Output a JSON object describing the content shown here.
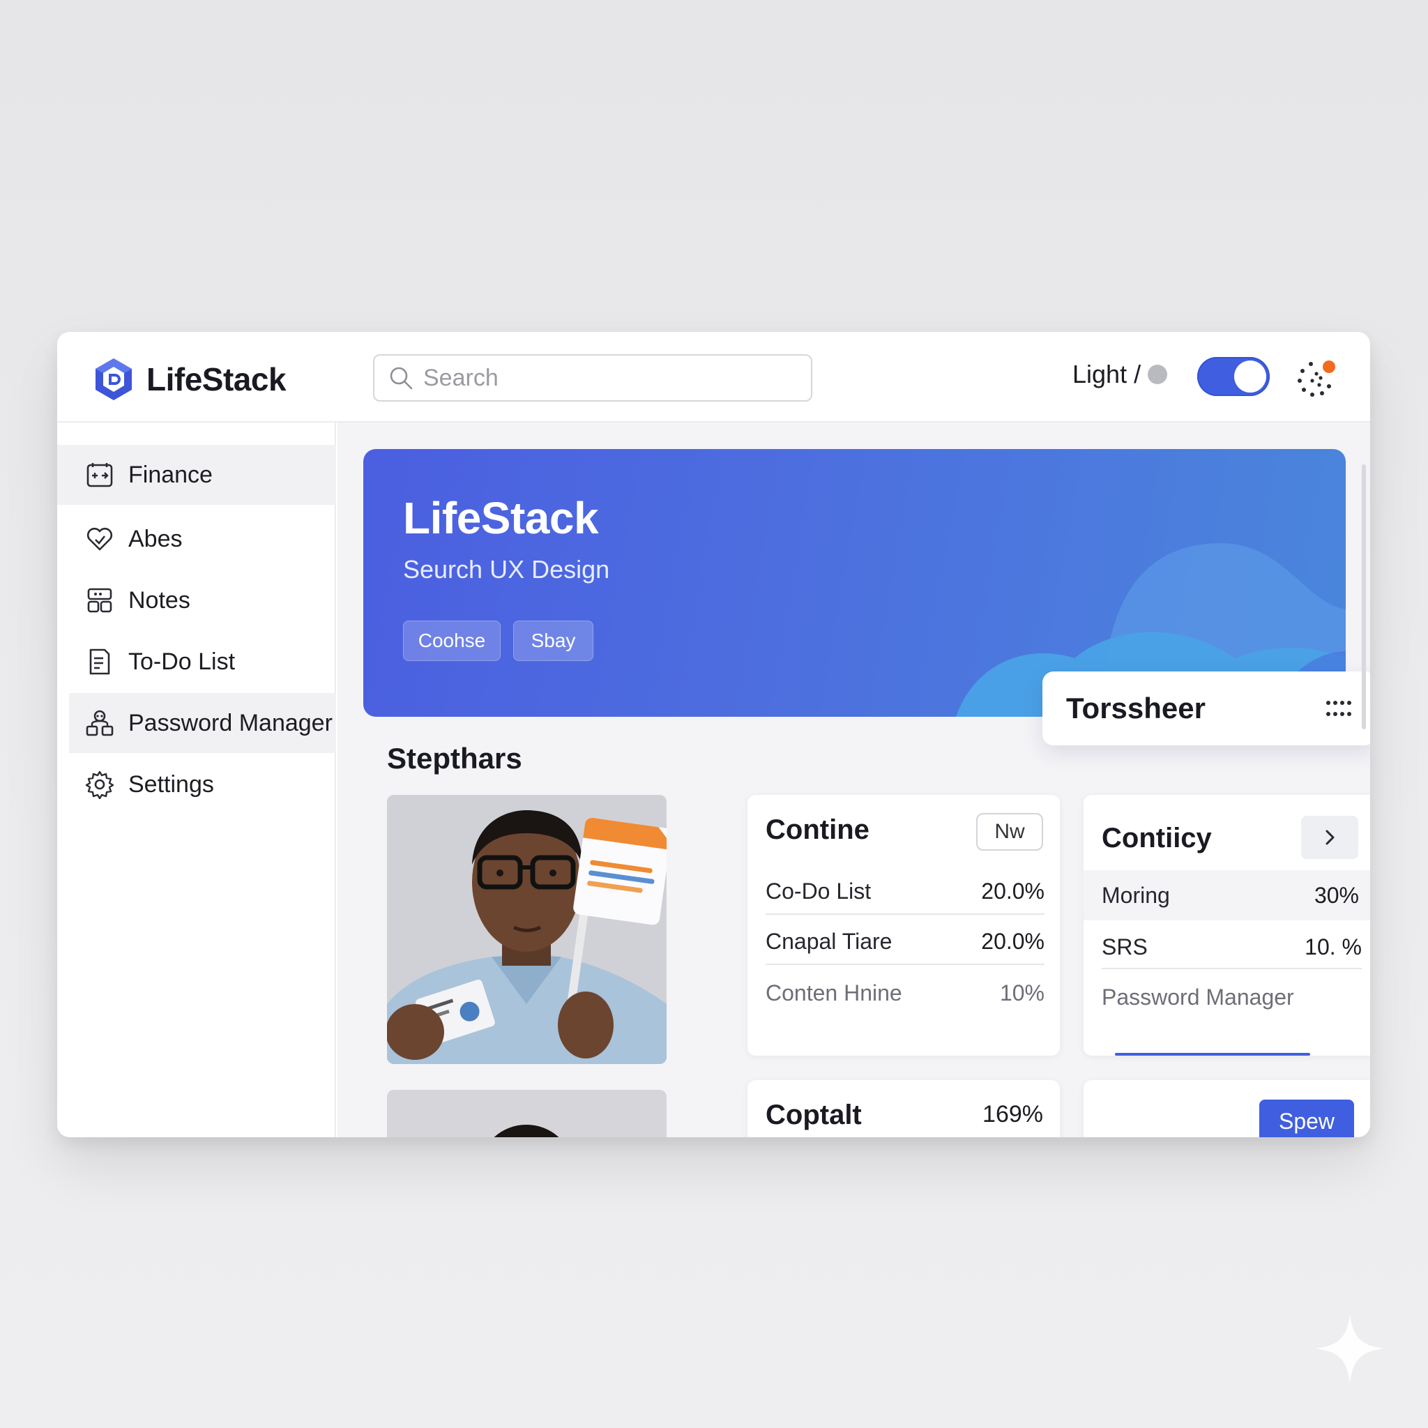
{
  "app": {
    "name": "LifeStack"
  },
  "header": {
    "search": {
      "placeholder": "Search",
      "value": ""
    },
    "theme_label": "Light /",
    "toggle_on": true,
    "notification_badge_color": "#f26b1d"
  },
  "sidebar": {
    "items": [
      {
        "label": "Finance",
        "icon": "finance-icon",
        "active": true
      },
      {
        "label": "Abes",
        "icon": "heart-icon"
      },
      {
        "label": "Notes",
        "icon": "notes-icon"
      },
      {
        "label": "To-Do List",
        "icon": "todo-icon"
      },
      {
        "label": "Password Manager",
        "icon": "password-icon",
        "highlighted": true
      },
      {
        "label": "Settings",
        "icon": "gear-icon"
      }
    ]
  },
  "hero": {
    "title": "LifeStack",
    "subtitle": "Seurch UX Design",
    "buttons": [
      "Coohse",
      "Sbay"
    ]
  },
  "popover": {
    "title": "Torssheer",
    "icon": "grid-dots-icon"
  },
  "section": {
    "title": "Stepthars"
  },
  "cards": {
    "contine": {
      "title": "Contine",
      "badge": "Nw",
      "rows": [
        {
          "label": "Co-Do List",
          "value": "20.0%"
        },
        {
          "label": "Cnapal Tiare",
          "value": "20.0%"
        },
        {
          "label": "Conten Hnine",
          "value": "10%"
        }
      ]
    },
    "contiicy": {
      "title": "Contiicy",
      "rows": [
        {
          "label": "Moring",
          "value": "30%"
        },
        {
          "label": "SRS",
          "value": "10. %"
        }
      ],
      "footer": "Password Manager"
    },
    "coptalt": {
      "title": "Coptalt",
      "value": "169%"
    },
    "spew": {
      "button": "Spew"
    }
  },
  "colors": {
    "accent": "#3f5fe0",
    "hero_start": "#4b5fe0",
    "hero_end": "#4a86dc"
  }
}
